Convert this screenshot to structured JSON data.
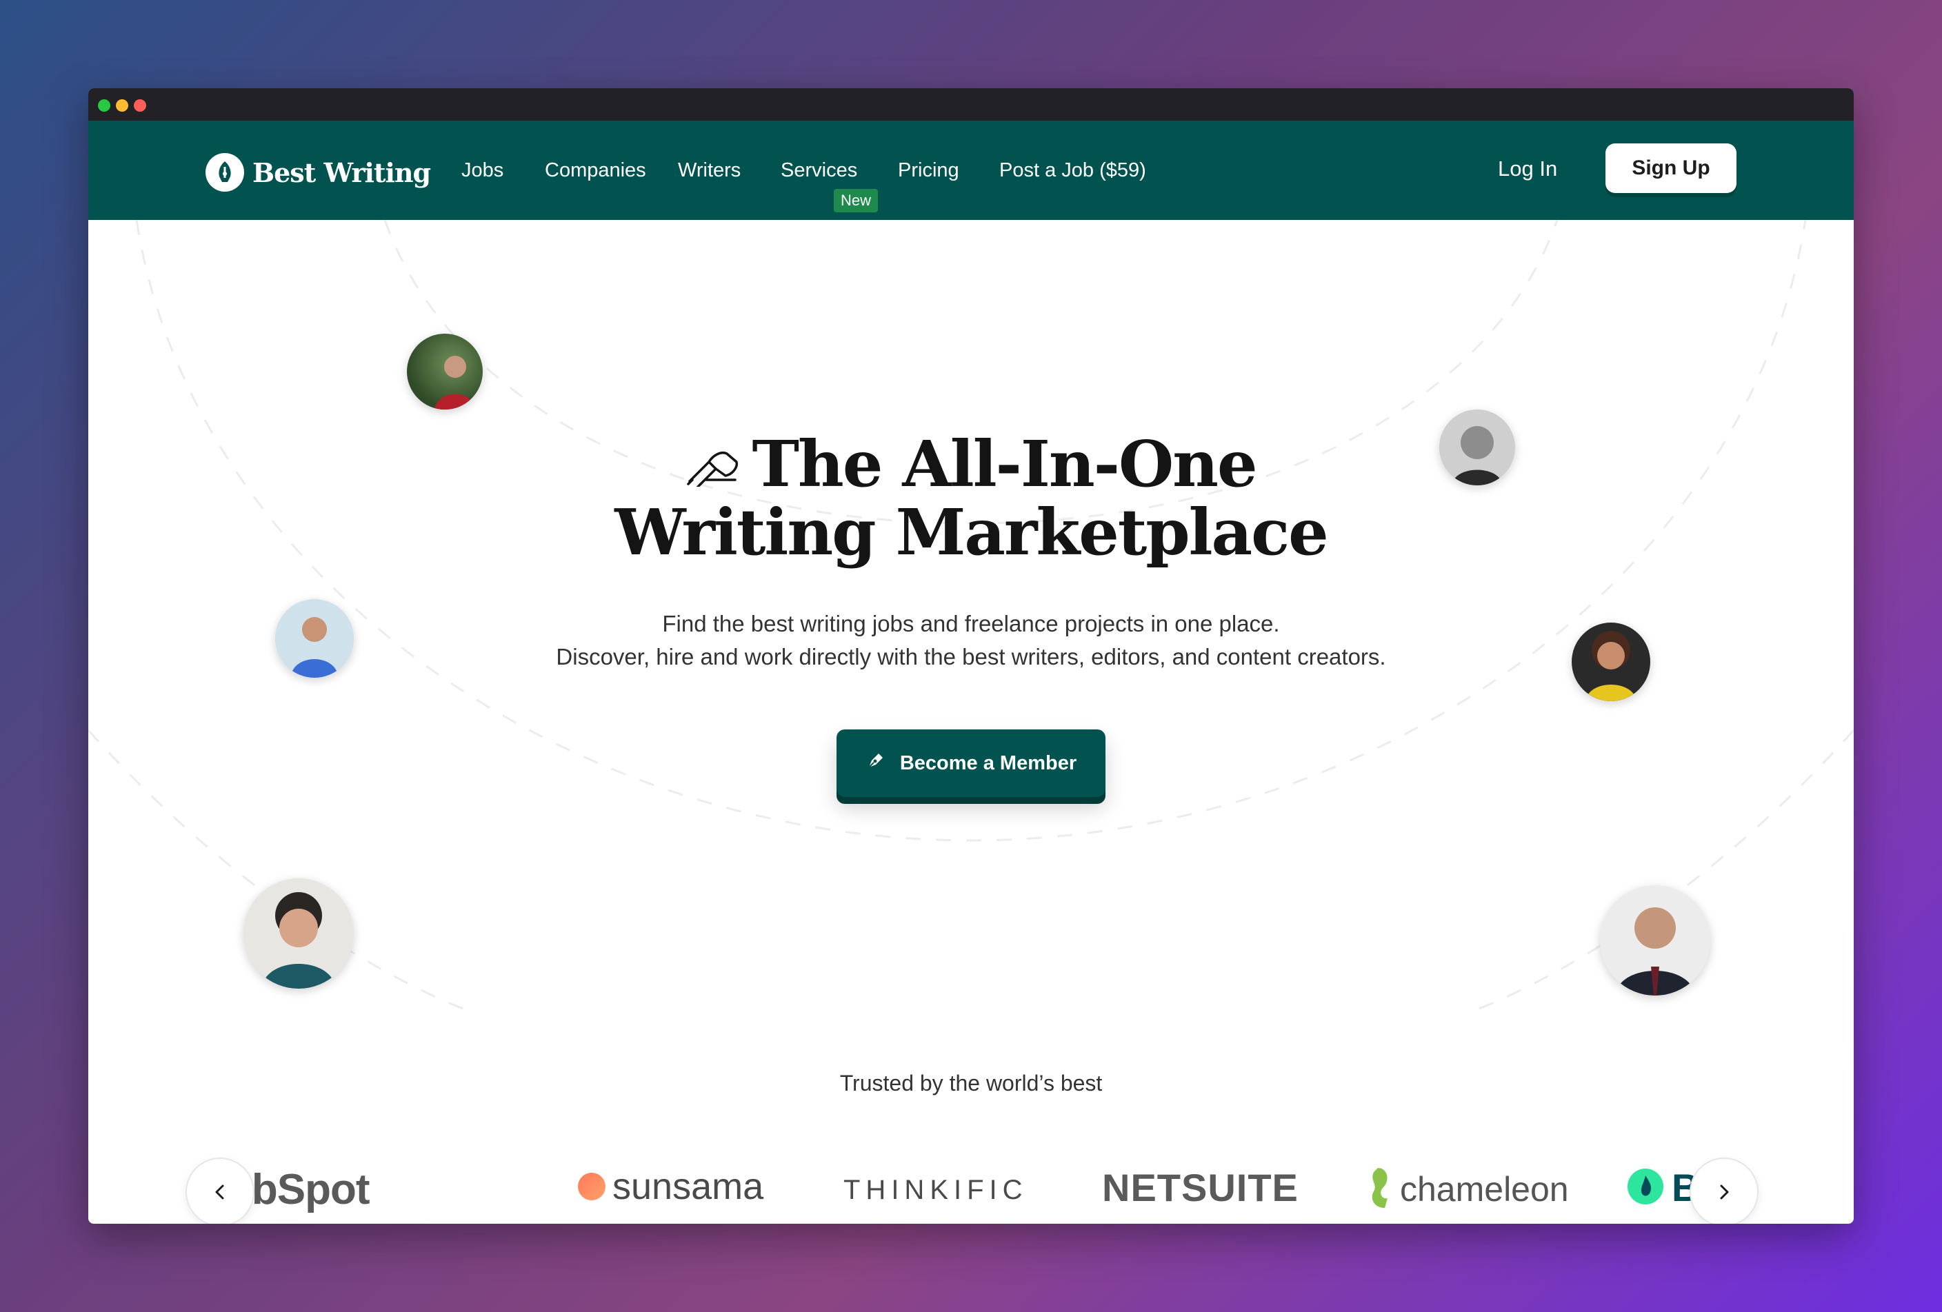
{
  "window": {
    "controls": [
      "close",
      "minimize",
      "maximize"
    ]
  },
  "nav": {
    "logo_text": "Best Writing",
    "links": [
      "Jobs",
      "Companies",
      "Writers",
      "Services",
      "Pricing",
      "Post a Job ($59)"
    ],
    "badge": "New",
    "login": "Log In",
    "signup": "Sign Up",
    "background": "#02534f"
  },
  "hero": {
    "title_line1": "The All-In-One",
    "title_line2": "Writing Marketplace",
    "subtitle_line1": "Find the best writing jobs and freelance projects in one place.",
    "subtitle_line2": "Discover, hire and work directly with the best writers, editors, and content creators.",
    "cta": "Become a Member"
  },
  "trusted": {
    "heading": "Trusted by the world’s best",
    "logos": [
      "ubSpot",
      "sunsama",
      "THINKIFIC",
      "NETSUITE",
      "chameleon",
      "Blinkis"
    ]
  },
  "colors": {
    "accent": "#02534f",
    "badge": "#1e8a4d"
  }
}
